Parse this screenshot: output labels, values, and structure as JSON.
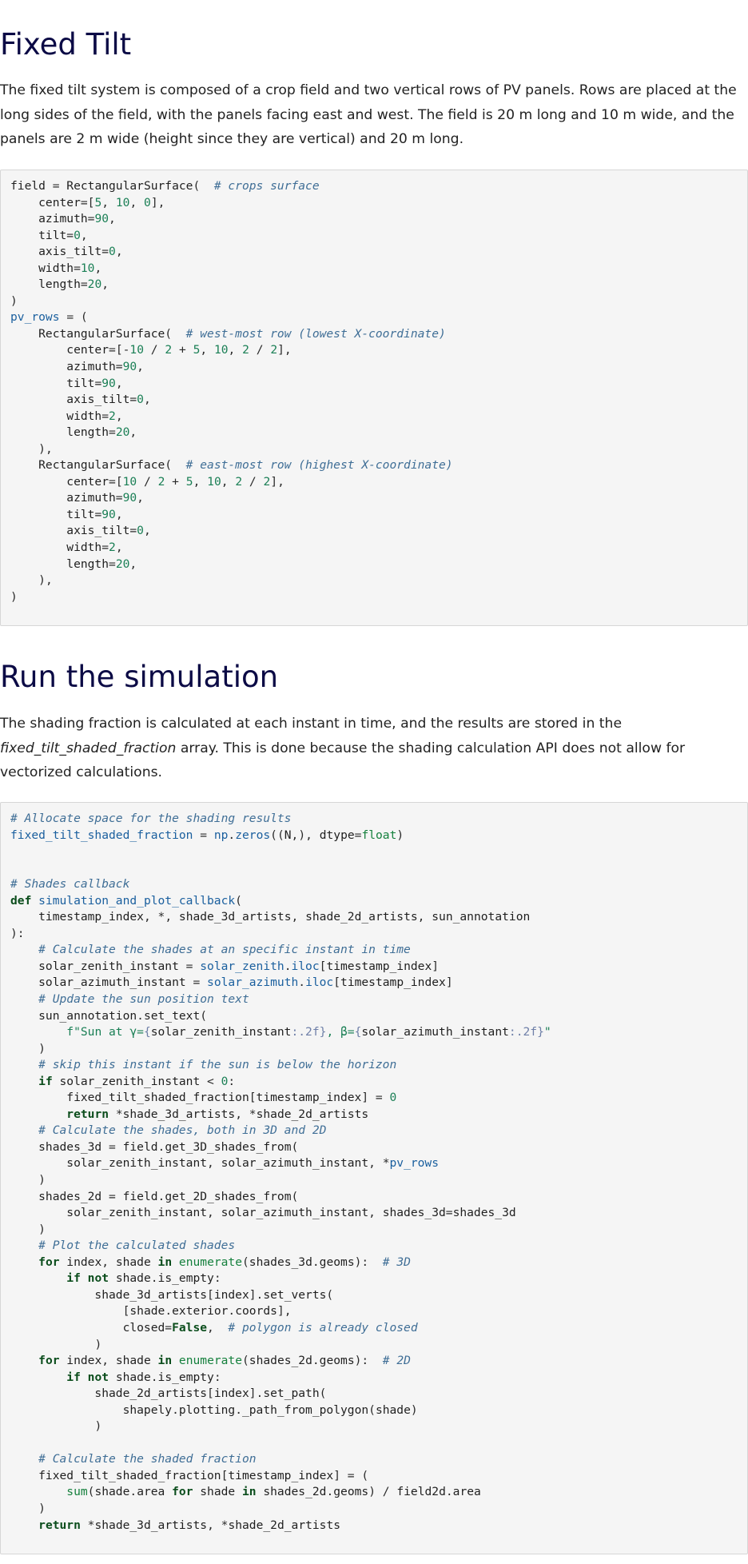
{
  "section1": {
    "heading": "Fixed Tilt",
    "paragraph": "The fixed tilt system is composed of a crop field and two vertical rows of PV panels. Rows are placed at the long sides of the field, with the panels facing east and west. The field is 20 m long and 10 m wide, and the panels are 2 m wide (height since they are vertical) and 20 m long."
  },
  "section2": {
    "heading": "Run the simulation",
    "paragraph_before": "The shading fraction is calculated at each instant in time, and the results are stored in the",
    "paragraph_em": "fixed_tilt_shaded_fraction",
    "paragraph_after": "array. This is done because the shading calculation API does not allow for vectorized calculations."
  },
  "code1": {
    "lines": [
      "field = RectangularSurface(  # crops surface",
      "    center=[5, 10, 0],",
      "    azimuth=90,",
      "    tilt=0,",
      "    axis_tilt=0,",
      "    width=10,",
      "    length=20,",
      ")",
      "pv_rows = (",
      "    RectangularSurface(  # west-most row (lowest X-coordinate)",
      "        center=[-10 / 2 + 5, 10, 2 / 2],",
      "        azimuth=90,",
      "        tilt=90,",
      "        axis_tilt=0,",
      "        width=2,",
      "        length=20,",
      "    ),",
      "    RectangularSurface(  # east-most row (highest X-coordinate)",
      "        center=[10 / 2 + 5, 10, 2 / 2],",
      "        azimuth=90,",
      "        tilt=90,",
      "        axis_tilt=0,",
      "        width=2,",
      "        length=20,",
      "    ),",
      ")"
    ]
  },
  "code2": {
    "lines": [
      "# Allocate space for the shading results",
      "fixed_tilt_shaded_fraction = np.zeros((N,), dtype=float)",
      "",
      "",
      "# Shades callback",
      "def simulation_and_plot_callback(",
      "    timestamp_index, *, shade_3d_artists, shade_2d_artists, sun_annotation",
      "):",
      "    # Calculate the shades at an specific instant in time",
      "    solar_zenith_instant = solar_zenith.iloc[timestamp_index]",
      "    solar_azimuth_instant = solar_azimuth.iloc[timestamp_index]",
      "    # Update the sun position text",
      "    sun_annotation.set_text(",
      "        f\"Sun at γ={solar_zenith_instant:.2f}, β={solar_azimuth_instant:.2f}\"",
      "    )",
      "    # skip this instant if the sun is below the horizon",
      "    if solar_zenith_instant < 0:",
      "        fixed_tilt_shaded_fraction[timestamp_index] = 0",
      "        return *shade_3d_artists, *shade_2d_artists",
      "    # Calculate the shades, both in 3D and 2D",
      "    shades_3d = field.get_3D_shades_from(",
      "        solar_zenith_instant, solar_azimuth_instant, *pv_rows",
      "    )",
      "    shades_2d = field.get_2D_shades_from(",
      "        solar_zenith_instant, solar_azimuth_instant, shades_3d=shades_3d",
      "    )",
      "    # Plot the calculated shades",
      "    for index, shade in enumerate(shades_3d.geoms):  # 3D",
      "        if not shade.is_empty:",
      "            shade_3d_artists[index].set_verts(",
      "                [shade.exterior.coords],",
      "                closed=False,  # polygon is already closed",
      "            )",
      "    for index, shade in enumerate(shades_2d.geoms):  # 2D",
      "        if not shade.is_empty:",
      "            shade_2d_artists[index].set_path(",
      "                shapely.plotting._path_from_polygon(shade)",
      "            )",
      "",
      "    # Calculate the shaded fraction",
      "    fixed_tilt_shaded_fraction[timestamp_index] = (",
      "        sum(shade.area for shade in shades_2d.geoms) / field2d.area",
      "    )",
      "    return *shade_3d_artists, *shade_2d_artists"
    ]
  }
}
